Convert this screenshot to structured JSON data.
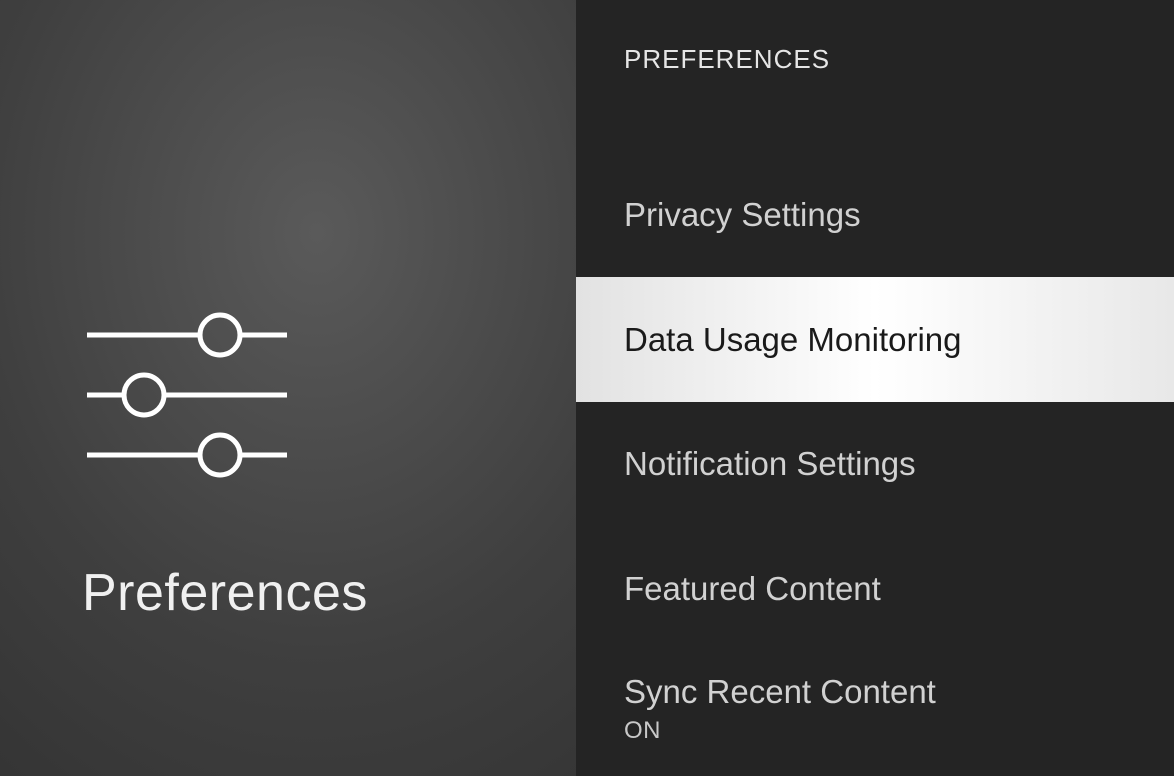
{
  "left": {
    "title": "Preferences"
  },
  "right": {
    "header": "PREFERENCES",
    "items": [
      {
        "label": "Privacy Settings",
        "value": null,
        "selected": false
      },
      {
        "label": "Data Usage Monitoring",
        "value": null,
        "selected": true
      },
      {
        "label": "Notification Settings",
        "value": null,
        "selected": false
      },
      {
        "label": "Featured Content",
        "value": null,
        "selected": false
      },
      {
        "label": "Sync Recent Content",
        "value": "ON",
        "selected": false
      }
    ]
  }
}
